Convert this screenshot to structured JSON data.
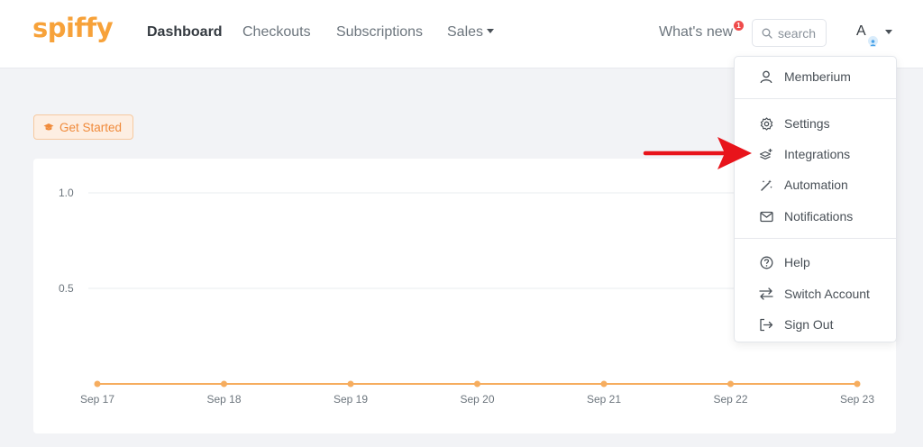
{
  "brand": {
    "logo_text": "spiffy",
    "color": "#f7a23a"
  },
  "nav": {
    "items": [
      {
        "label": "Dashboard",
        "active": true
      },
      {
        "label": "Checkouts"
      },
      {
        "label": "Subscriptions"
      },
      {
        "label": "Sales",
        "dropdown": true
      }
    ],
    "whats_new": {
      "label": "What's new",
      "badge_count": "1"
    },
    "search": {
      "placeholder": "search",
      "icon": "search-icon"
    },
    "user": {
      "initial": "A"
    }
  },
  "get_started": {
    "label": "Get Started",
    "icon": "graduation-cap-icon"
  },
  "user_menu": {
    "account": {
      "label": "Memberium",
      "icon": "user-icon"
    },
    "items": [
      {
        "label": "Settings",
        "icon": "gear-icon"
      },
      {
        "label": "Integrations",
        "icon": "integrations-icon"
      },
      {
        "label": "Automation",
        "icon": "magic-wand-icon"
      },
      {
        "label": "Notifications",
        "icon": "envelope-icon"
      }
    ],
    "footer_items": [
      {
        "label": "Help",
        "icon": "question-circle-icon"
      },
      {
        "label": "Switch Account",
        "icon": "switch-arrows-icon"
      },
      {
        "label": "Sign Out",
        "icon": "sign-out-icon"
      }
    ]
  },
  "annotation": {
    "icon": "red-arrow-icon",
    "color": "#e8141b",
    "points_to": "Integrations"
  },
  "chart_data": {
    "type": "line",
    "categories": [
      "Sep 17",
      "Sep 18",
      "Sep 19",
      "Sep 20",
      "Sep 21",
      "Sep 22",
      "Sep 23"
    ],
    "series": [
      {
        "values": [
          0,
          0,
          0,
          0,
          0,
          0,
          0
        ],
        "color": "#f6ad5f"
      }
    ],
    "yticks": [
      "1.0",
      "0.5"
    ],
    "ylim": [
      0,
      1.0
    ],
    "grid": true,
    "title": "",
    "xlabel": "",
    "ylabel": ""
  }
}
